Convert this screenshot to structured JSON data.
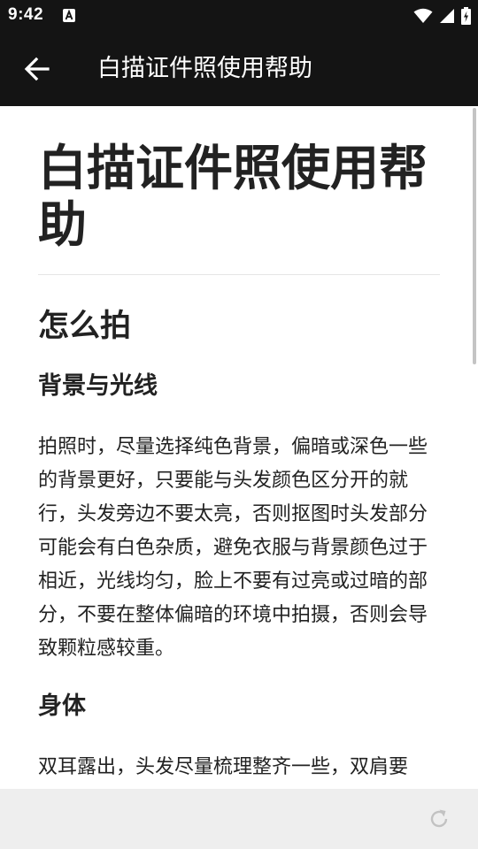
{
  "status_bar": {
    "time": "9:42",
    "notification_icon": "a-notification-icon",
    "icons": [
      "wifi-icon",
      "cellular-signal-icon",
      "battery-charging-icon"
    ]
  },
  "app_bar": {
    "back_icon": "arrow-left-icon",
    "title": "白描证件照使用帮助"
  },
  "article": {
    "title": "白描证件照使用帮助",
    "section_heading": "怎么拍",
    "subsection_1_heading": "背景与光线",
    "subsection_1_body": "拍照时，尽量选择纯色背景，偏暗或深色一些的背景更好，只要能与头发颜色区分开的就行，头发旁边不要太亮，否则抠图时头发部分可能会有白色杂质，避免衣服与背景颜色过于相近，光线均匀，脸上不要有过亮或过暗的部分，不要在整体偏暗的环境中拍摄，否则会导致颗粒感较重。",
    "subsection_2_heading": "身体",
    "subsection_2_body": "双耳露出，头发尽量梳理整齐一些，双肩要"
  },
  "bottom_bar": {
    "refresh_icon": "refresh-icon"
  },
  "colors": {
    "app_bar_bg": "#141414",
    "text": "#222222",
    "bottom_bar_bg": "#eeeeee"
  }
}
